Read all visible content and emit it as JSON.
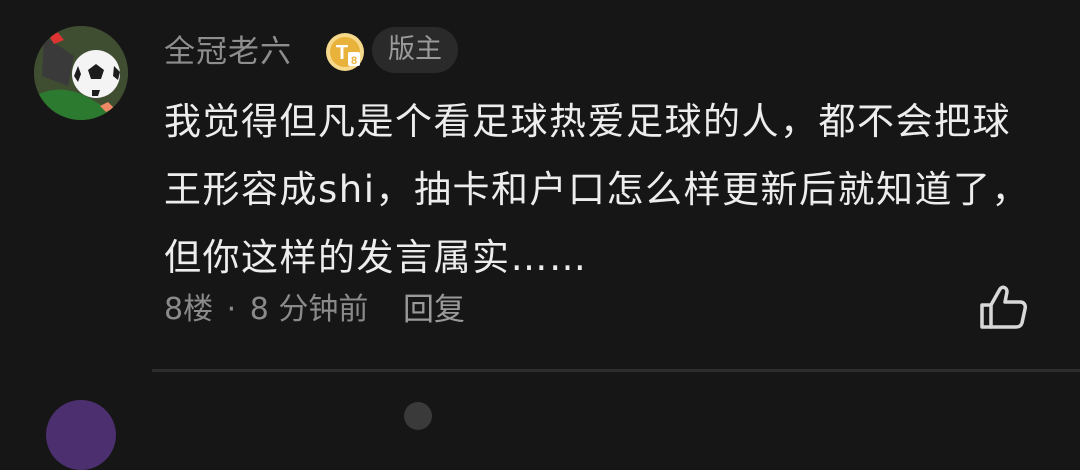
{
  "comment": {
    "username": "全冠老六",
    "level_badge_letter": "T",
    "level_badge_number": "8",
    "role_badge": "版主",
    "text": "我觉得但凡是个看足球热爱足球的人，都不会把球王形容成shi，抽卡和户口怎么样更新后就知道了，但你这样的发言属实……",
    "floor": "8楼",
    "separator": "·",
    "time": "8 分钟前",
    "reply_label": "回复"
  },
  "colors": {
    "background": "#161616",
    "username": "#8e8e8e",
    "text": "#ededed",
    "meta": "#8a8a8a",
    "badge_gold": "#e9b23a",
    "divider": "#2d2d2d"
  },
  "icons": {
    "avatar": "football-avatar",
    "level": "level-badge-icon",
    "like": "thumbs-up-icon"
  }
}
